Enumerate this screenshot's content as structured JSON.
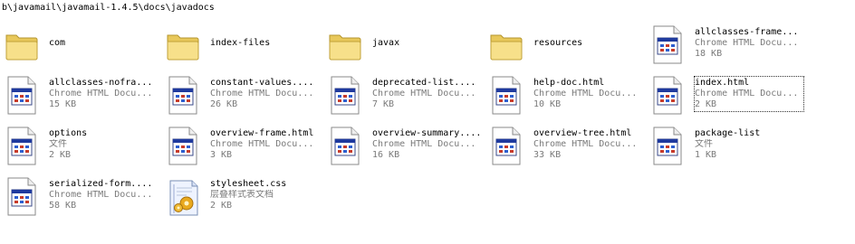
{
  "address": "b\\javamail\\javamail-1.4.5\\docs\\javadocs",
  "items": [
    {
      "name": "com",
      "type": "",
      "size": "",
      "icon": "folder-icon"
    },
    {
      "name": "index-files",
      "type": "",
      "size": "",
      "icon": "folder-icon"
    },
    {
      "name": "javax",
      "type": "",
      "size": "",
      "icon": "folder-icon"
    },
    {
      "name": "resources",
      "type": "",
      "size": "",
      "icon": "folder-icon"
    },
    {
      "name": "allclasses-frame...",
      "type": "Chrome HTML Docu...",
      "size": "18 KB",
      "icon": "html-document-icon"
    },
    {
      "name": "allclasses-nofra...",
      "type": "Chrome HTML Docu...",
      "size": "15 KB",
      "icon": "html-document-icon"
    },
    {
      "name": "constant-values....",
      "type": "Chrome HTML Docu...",
      "size": "26 KB",
      "icon": "html-document-icon"
    },
    {
      "name": "deprecated-list....",
      "type": "Chrome HTML Docu...",
      "size": "7 KB",
      "icon": "html-document-icon"
    },
    {
      "name": "help-doc.html",
      "type": "Chrome HTML Docu...",
      "size": "10 KB",
      "icon": "html-document-icon"
    },
    {
      "name": "index.html",
      "type": "Chrome HTML Docu...",
      "size": "2 KB",
      "icon": "html-document-icon",
      "selected": true
    },
    {
      "name": "options",
      "type": "文件",
      "size": "2 KB",
      "icon": "html-document-icon"
    },
    {
      "name": "overview-frame.html",
      "type": "Chrome HTML Docu...",
      "size": "3 KB",
      "icon": "html-document-icon"
    },
    {
      "name": "overview-summary....",
      "type": "Chrome HTML Docu...",
      "size": "16 KB",
      "icon": "html-document-icon"
    },
    {
      "name": "overview-tree.html",
      "type": "Chrome HTML Docu...",
      "size": "33 KB",
      "icon": "html-document-icon"
    },
    {
      "name": "package-list",
      "type": "文件",
      "size": "1 KB",
      "icon": "html-document-icon"
    },
    {
      "name": "serialized-form....",
      "type": "Chrome HTML Docu...",
      "size": "58 KB",
      "icon": "html-document-icon"
    },
    {
      "name": "stylesheet.css",
      "type": "层叠样式表文档",
      "size": "2 KB",
      "icon": "css-document-icon"
    }
  ]
}
